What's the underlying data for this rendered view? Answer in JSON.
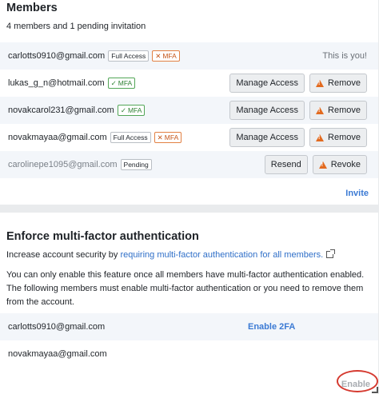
{
  "members": {
    "title": "Members",
    "subtitle": "4 members and 1 pending invitation",
    "rows": [
      {
        "email": "carlotts0910@gmail.com",
        "badges": [
          "Full Access",
          "MFA"
        ],
        "you_label": "This is you!"
      },
      {
        "email": "lukas_g_n@hotmail.com",
        "badges": [
          "MFA"
        ],
        "manage": "Manage Access",
        "remove": "Remove"
      },
      {
        "email": "novakcarol231@gmail.com",
        "badges": [
          "MFA"
        ],
        "manage": "Manage Access",
        "remove": "Remove"
      },
      {
        "email": "novakmayaa@gmail.com",
        "badges": [
          "Full Access",
          "MFA"
        ],
        "manage": "Manage Access",
        "remove": "Remove"
      },
      {
        "email": "carolinepe1095@gmail.com",
        "badges": [
          "Pending"
        ],
        "resend": "Resend",
        "revoke": "Revoke"
      }
    ],
    "invite": "Invite"
  },
  "mfa": {
    "title": "Enforce multi-factor authentication",
    "p1_prefix": "Increase account security by ",
    "p1_link": "requiring multi-factor authentication for all members.",
    "p2": "You can only enable this feature once all members have multi-factor authentication enabled. The following members must enable multi-factor authentication or you need to remove them from the account.",
    "rows": [
      {
        "email": "carlotts0910@gmail.com",
        "action": "Enable 2FA"
      },
      {
        "email": "novakmayaa@gmail.com"
      }
    ],
    "enable": "Enable"
  },
  "colors": {
    "accent": "#3b7ad4",
    "mfa_ok": "#2f8234",
    "mfa_missing": "#c5561a",
    "highlight_circle": "#d53a30"
  },
  "icons": {
    "mfa_ok": "check-icon",
    "mfa_missing": "x-icon",
    "remove": "warning-icon",
    "external": "external-link-icon"
  }
}
